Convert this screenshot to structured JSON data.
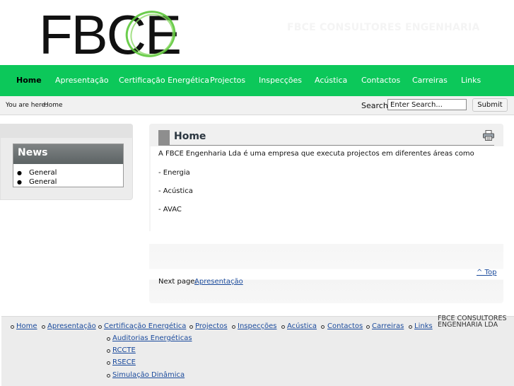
{
  "header": {
    "logo_text": "FBCE",
    "tagline": "FBCE CONSULTORES ENGENHARIA"
  },
  "nav": {
    "items": [
      "Home",
      "Apresentação",
      "Certificação Energética",
      "Projectos",
      "Inspecções",
      "Acústica",
      "Contactos",
      "Carreiras",
      "Links"
    ],
    "active": "Home"
  },
  "breadcrumb": {
    "label": "You are here:",
    "current": "Home"
  },
  "search": {
    "label": "Search:",
    "value": "Enter Search...",
    "button": "Submit"
  },
  "news": {
    "title": "News",
    "items": [
      "General",
      "General"
    ]
  },
  "content": {
    "title": "Home",
    "paragraphs": [
      "A FBCE Engenharia Lda é uma empresa que executa projectos em diferentes áreas como",
      "- Energia",
      "- Acústica",
      "- AVAC"
    ],
    "top_link": "^ Top",
    "next_label": "Next page:",
    "next_link": "Apresentação"
  },
  "footer": {
    "links": [
      "Home",
      "Apresentação",
      "Certificação Energética",
      "Projectos",
      "Inspecções",
      "Acústica",
      "Contactos",
      "Carreiras",
      "Links"
    ],
    "sublinks": [
      "Auditorias Energéticas",
      "RCCTE",
      "RSECE",
      "Simulação Dinâmica"
    ],
    "company": "FBCE CONSULTORES ENGENHARIA LDA"
  },
  "colors": {
    "nav_green": "#0cc85a",
    "link_blue": "#1a4a9c",
    "logo_green": "#5cc83a"
  }
}
